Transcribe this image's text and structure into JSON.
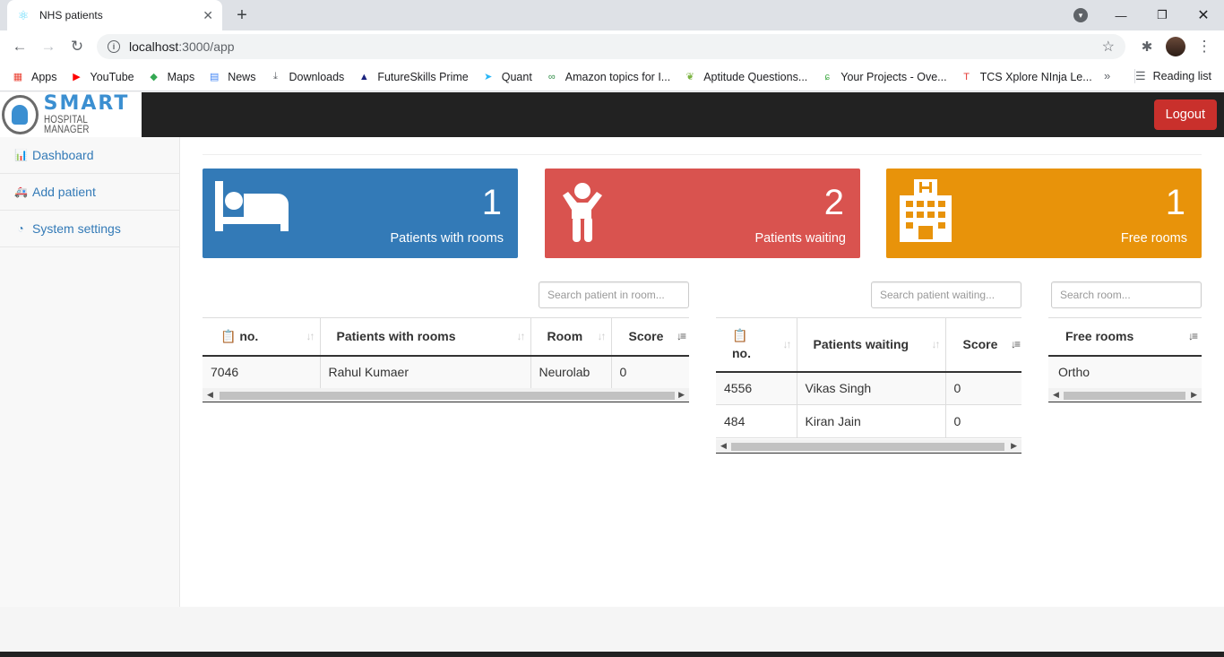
{
  "browser": {
    "tab_title": "NHS patients",
    "tab_favicon": "react-icon",
    "url_host": "localhost",
    "url_rest": ":3000/app",
    "bookmarks": [
      {
        "label": "Apps",
        "icon": "apps-grid-icon",
        "color": "#ea4335"
      },
      {
        "label": "YouTube",
        "icon": "youtube-icon",
        "color": "#ff0000"
      },
      {
        "label": "Maps",
        "icon": "maps-icon",
        "color": "#34a853"
      },
      {
        "label": "News",
        "icon": "news-icon",
        "color": "#4285f4"
      },
      {
        "label": "Downloads",
        "icon": "download-icon",
        "color": "#5f6368"
      },
      {
        "label": "FutureSkills Prime",
        "icon": "futureskills-icon",
        "color": "#1a237e"
      },
      {
        "label": "Quant",
        "icon": "quant-icon",
        "color": "#29b6f6"
      },
      {
        "label": "Amazon topics for I...",
        "icon": "gfg-icon",
        "color": "#2f8d46"
      },
      {
        "label": "Aptitude Questions...",
        "icon": "leaf-icon",
        "color": "#7cb342"
      },
      {
        "label": "Your Projects - Ove...",
        "icon": "overleaf-icon",
        "color": "#4caf50"
      },
      {
        "label": "TCS Xplore NInja Le...",
        "icon": "tcs-icon",
        "color": "#e53935"
      }
    ],
    "reading_list": "Reading list"
  },
  "app": {
    "logo_smart": "SMART",
    "logo_sub": "HOSPITAL MANAGER",
    "logout_label": "Logout",
    "sidebar": [
      {
        "label": "Dashboard",
        "icon": "bar-chart-icon"
      },
      {
        "label": "Add patient",
        "icon": "ambulance-icon"
      },
      {
        "label": "System settings",
        "icon": "dashboard-gauge-icon"
      }
    ],
    "panels": [
      {
        "value": "1",
        "label": "Patients with rooms",
        "icon": "bed-icon",
        "color": "#337ab7"
      },
      {
        "value": "2",
        "label": "Patients waiting",
        "icon": "child-icon",
        "color": "#d9534f"
      },
      {
        "value": "1",
        "label": "Free rooms",
        "icon": "hospital-building-icon",
        "color": "#e8930a"
      }
    ],
    "rooms_table": {
      "search_placeholder": "Search patient in room...",
      "headers": [
        "no.",
        "Patients with rooms",
        "Room",
        "Score"
      ],
      "rows": [
        [
          "7046",
          "Rahul Kumaer",
          "Neurolab",
          "0"
        ]
      ]
    },
    "waiting_table": {
      "search_placeholder": "Search patient waiting...",
      "headers": [
        "no.",
        "Patients waiting",
        "Score"
      ],
      "rows": [
        [
          "4556",
          "Vikas Singh",
          "0"
        ],
        [
          "484",
          "Kiran Jain",
          "0"
        ]
      ]
    },
    "free_table": {
      "search_placeholder": "Search room...",
      "headers": [
        "Free rooms"
      ],
      "rows": [
        [
          "Ortho"
        ]
      ]
    }
  }
}
